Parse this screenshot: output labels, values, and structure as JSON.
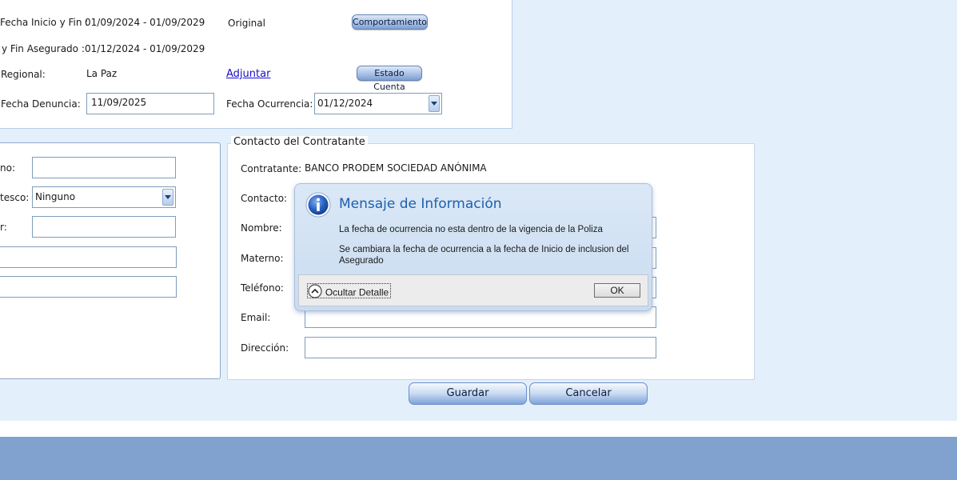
{
  "policy": {
    "fecha_inicio_fin_label": "Fecha Inicio y Fin :",
    "fecha_inicio_fin_value": "01/09/2024 - 01/09/2029",
    "status": "Original",
    "comportamiento_button": "Comportamiento",
    "asegurado_label": "y Fin Asegurado :",
    "asegurado_value": "01/12/2024 - 01/09/2029",
    "regional_label": "Regional:",
    "regional_value": "La Paz",
    "adjuntar_link": "Adjuntar",
    "estado_cuenta_button": "Estado Cuenta",
    "fecha_denuncia_label": "Fecha Denuncia:",
    "fecha_denuncia_value": "11/09/2025",
    "fecha_ocurrencia_label": "Fecha Ocurrencia:",
    "fecha_ocurrencia_value": "01/12/2024"
  },
  "left_form": {
    "row1_label": "no:",
    "parentesco_label": "tesco:",
    "parentesco_value": "Ninguno",
    "row3_label": "r:"
  },
  "contact": {
    "legend": "Contacto del Contratante",
    "contratante_label": "Contratante:",
    "contratante_value": "BANCO PRODEM SOCIEDAD ANÓNIMA",
    "contacto_label": "Contacto:",
    "nombre_label": "Nombre:",
    "materno_label": "Materno:",
    "telefono_label": "Teléfono:",
    "email_label": "Email:",
    "direccion_label": "Dirección:"
  },
  "actions": {
    "guardar": "Guardar",
    "cancelar": "Cancelar"
  },
  "dialog": {
    "title": "Mensaje de Información",
    "line1": "La fecha de ocurrencia no esta dentro de la vigencia de la Poliza",
    "line2": "Se cambiara la fecha de ocurrencia a la fecha de Inicio de inclusion del Asegurado",
    "toggle_label": "Ocultar Detalle",
    "ok": "OK"
  },
  "colors": {
    "page_bg": "#e3effb",
    "footer_band": "#81a1cf",
    "dialog_title": "#1e5fae"
  }
}
